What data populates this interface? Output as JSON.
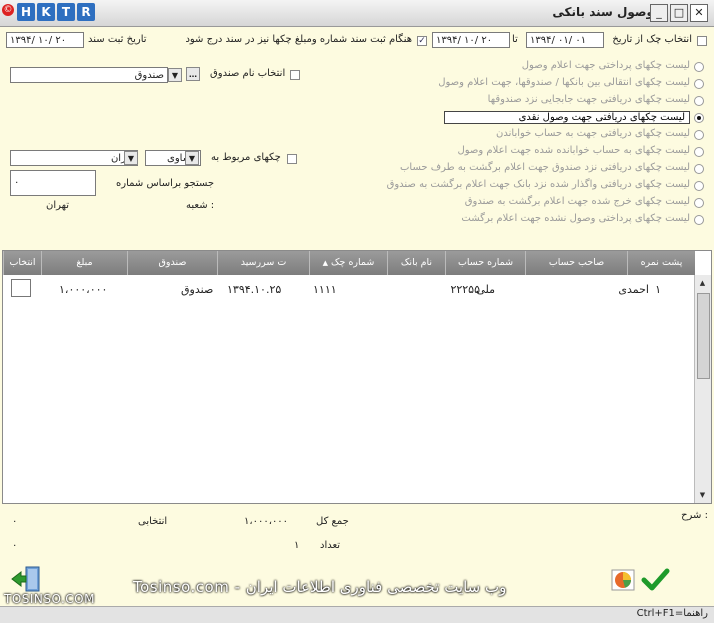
{
  "window": {
    "title": "وصول سند بانکی",
    "logo_letters": [
      "H",
      "K",
      "T",
      "R"
    ],
    "logo_mark": "©"
  },
  "header": {
    "from_date_label": "انتخاب چک از تاریخ",
    "from_date": "۱۳۹۴/ ۰۱/ ۰۱",
    "to_label": "تا",
    "to_date": "۱۳۹۴/ ۱۰/ ۲۰",
    "record_option": "هنگام ثبت سند شماره ومبلغ چکها نیز در سند درج شود",
    "record_date_label": "تاریخ ثبت سند",
    "record_date": "۱۳۹۴/ ۱۰/ ۲۰"
  },
  "filters": {
    "fund_label": "انتخاب نام صندوق",
    "fund_value": "صندوق",
    "related_label": "چکهای مربوط به",
    "operator_value": "مساوی",
    "city_value": "تهران",
    "search_label": "جستجو براساس شماره",
    "search_value": "۰",
    "branch_label": "شعبه :",
    "branch_value": "تهران"
  },
  "options": [
    {
      "label": "لیست چکهای پرداختی جهت اعلام وصول",
      "selected": false
    },
    {
      "label": "لیست چکهای انتقالی بین بانکها / صندوقها، جهت اعلام وصول",
      "selected": false
    },
    {
      "label": "لیست چکهای دریافتی جهت جابجایی نزد صندوقها",
      "selected": false
    },
    {
      "label": "لیست چکهای دریافتی جهت وصول نقدی",
      "selected": true
    },
    {
      "label": "لیست چکهای دریافتی جهت به حساب خواباندن",
      "selected": false
    },
    {
      "label": "لیست چکهای به حساب خوابانده شده جهت اعلام وصول",
      "selected": false
    },
    {
      "label": "لیست چکهای دریافتی نزد صندوق جهت اعلام برگشت به طرف حساب",
      "selected": false
    },
    {
      "label": "لیست چکهای دریافتی واگذار شده نزد بانک جهت اعلام برگشت به صندوق",
      "selected": false
    },
    {
      "label": "لیست چکهای خرج شده جهت اعلام برگشت به صندوق",
      "selected": false
    },
    {
      "label": "لیست چکهای پرداختی وصول نشده جهت اعلام برگشت",
      "selected": false
    }
  ],
  "grid": {
    "columns": [
      "پشت نمره",
      "صاحب حساب",
      "شماره حساب",
      "نام بانک",
      "شماره چک",
      "ت سررسید",
      "صندوق",
      "مبلغ",
      "انتخاب"
    ],
    "sort_mark": "▲",
    "rows": [
      {
        "row_no": "۱",
        "owner": "احمدی",
        "account": "۲۲۲۵۵",
        "bank": "ملی",
        "check_no": "۱۱۱۱",
        "due": "۱۳۹۴.۱۰.۲۵",
        "fund": "صندوق",
        "amount": "۱،۰۰۰،۰۰۰"
      }
    ]
  },
  "footer": {
    "description_label": "شرح :",
    "total_label": "جمع کل",
    "total_value": "۱،۰۰۰،۰۰۰",
    "selected_label": "انتخابی",
    "selected_value": "۰",
    "count_label": "تعداد",
    "count_value": "۱",
    "count_selected": "۰"
  },
  "watermark": {
    "text": "Tosinso.com - وب سایت تخصصی فناوری اطلاعات ایران",
    "corner": "TOSINSO.COM"
  },
  "statusbar": {
    "help": "Ctrl+F1=راهنما"
  },
  "icons": {
    "confirm": "check-icon",
    "chart": "chart-icon",
    "exit": "exit-door-icon"
  },
  "colors": {
    "background": "#fdfbe0",
    "grid_header": "#8a8a8a",
    "logo": "#2e6fc0",
    "confirm": "#1e9a2a"
  }
}
